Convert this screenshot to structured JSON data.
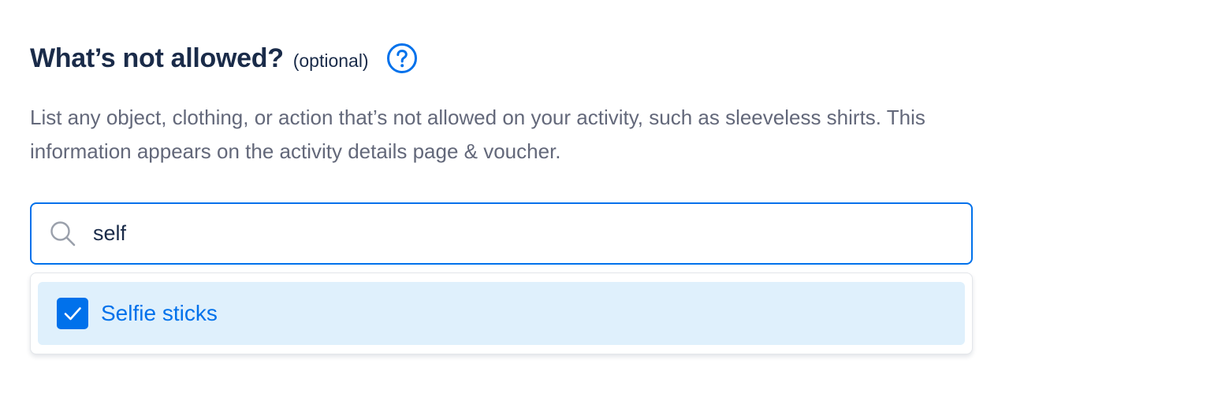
{
  "section": {
    "title": "What’s not allowed?",
    "optional_label": "(optional)",
    "help_icon": "question-circle-icon",
    "description": "List any object, clothing, or action that’s not allowed on your activity, such as sleeveless shirts. This information appears on the activity details page & voucher."
  },
  "search": {
    "icon": "search-icon",
    "value": "self",
    "placeholder": ""
  },
  "results": [
    {
      "label": "Selfie sticks",
      "checked": true
    }
  ],
  "colors": {
    "accent": "#0071eb",
    "heading": "#1a2b49",
    "body_text": "#63687a",
    "option_highlight": "#dff0fc"
  }
}
